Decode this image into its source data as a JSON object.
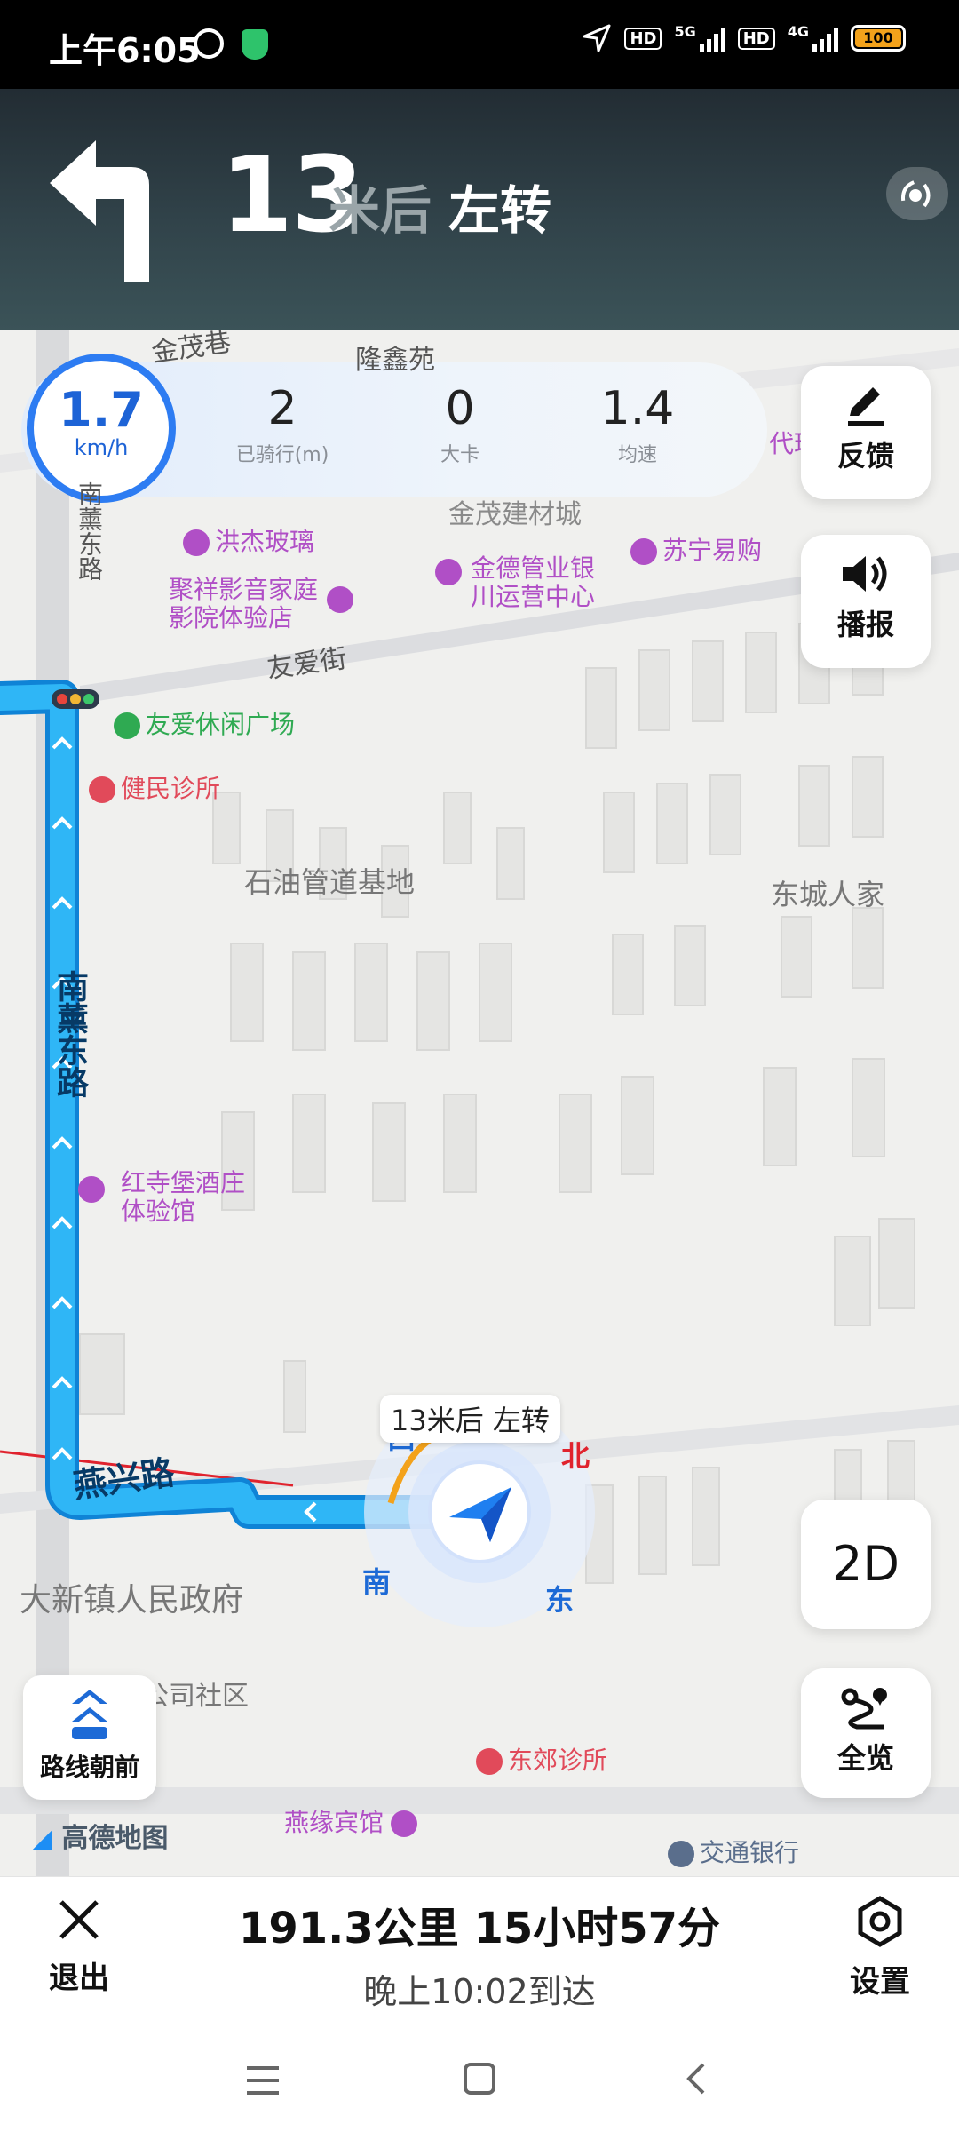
{
  "status_bar": {
    "time": "上午6:05",
    "hd_label": "HD",
    "net1": "5G",
    "net2": "4G",
    "battery": "100"
  },
  "guidance": {
    "distance": "13",
    "unit": "米后",
    "action": "左转"
  },
  "speed": {
    "value": "1.7",
    "unit": "km/h"
  },
  "stats": [
    {
      "value": "2",
      "label": "已骑行(m)"
    },
    {
      "value": "0",
      "label": "大卡"
    },
    {
      "value": "1.4",
      "label": "均速"
    }
  ],
  "side_buttons": {
    "feedback": "反馈",
    "broadcast": "播报",
    "view_mode": "2D",
    "overview": "全览",
    "route_heading": "路线朝前"
  },
  "map": {
    "street_labels": [
      "金茂巷",
      "隆鑫苑",
      "南薰东路",
      "友爱街",
      "南薰东路",
      "燕兴路"
    ],
    "area_labels": [
      "金茂建材城",
      "石油管道基地",
      "东城人家",
      "大新镇人民政府",
      "公司社区"
    ],
    "pois": [
      {
        "name": "洪杰玻璃",
        "color": "#b04fc6"
      },
      {
        "name": "聚祥影音家庭影院体验店",
        "color": "#b04fc6"
      },
      {
        "name": "金德管业银川运营中心",
        "color": "#b04fc6"
      },
      {
        "name": "苏宁易购",
        "color": "#b04fc6"
      },
      {
        "name": "友爱休闲广场",
        "color": "#2faa52"
      },
      {
        "name": "健民诊所",
        "color": "#e14a5a"
      },
      {
        "name": "红寺堡酒庄体验馆",
        "color": "#b04fc6"
      },
      {
        "name": "东郊诊所",
        "color": "#e14a5a"
      },
      {
        "name": "燕缘宾馆",
        "color": "#b04fc6"
      },
      {
        "name": "交通银行",
        "color": "#5a6e8c"
      },
      {
        "name": "代理",
        "color": "#b04fc6"
      }
    ],
    "compass": {
      "north": "北",
      "south": "南",
      "east": "东",
      "west": "西"
    },
    "callout": "13米后 左转",
    "brand": "高德地图",
    "route_color": "#1aa3f5"
  },
  "bottom": {
    "exit": "退出",
    "distance_time": "191.3公里  15小时57分",
    "arrival": "晚上10:02到达",
    "settings": "设置"
  }
}
